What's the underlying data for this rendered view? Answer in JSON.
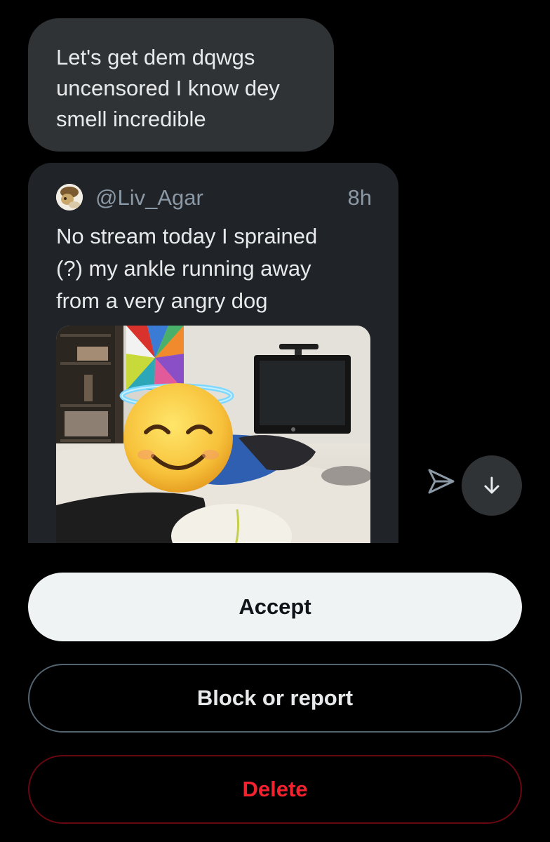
{
  "message": {
    "lines": [
      "Let's get dem dqwgs",
      "uncensored I know dey",
      "smell incredible"
    ]
  },
  "shared_tweet": {
    "handle": "@Liv_Agar",
    "time": "8h",
    "lines": [
      "No stream today I sprained",
      "(?) my ankle running away",
      "from a very angry dog"
    ],
    "photo_icon": "photo-with-emoji"
  },
  "icons": {
    "share": "send-arrow-icon",
    "scroll_down": "arrow-down-icon"
  },
  "actions": {
    "accept_label": "Accept",
    "block_label": "Block or report",
    "delete_label": "Delete"
  },
  "colors": {
    "background": "#000000",
    "bubble": "#2f3336",
    "card": "#202327",
    "accept_bg": "#eff3f4",
    "delete_text": "#f4212e",
    "delete_border": "#67070f"
  }
}
